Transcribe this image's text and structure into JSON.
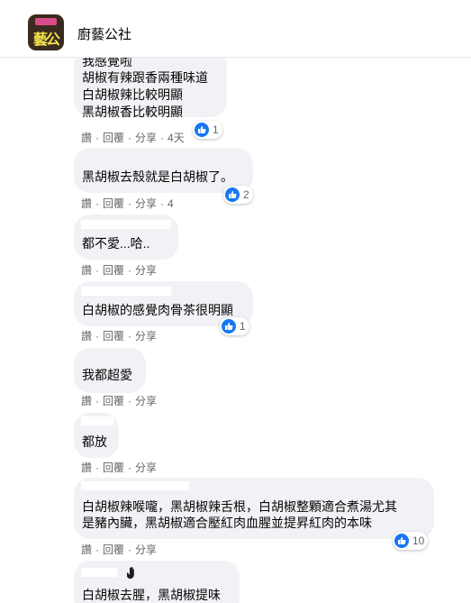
{
  "header": {
    "title": "廚藝公社",
    "avatar_text": "藝公"
  },
  "actions": {
    "like": "讚",
    "reply": "回覆",
    "share": "分享"
  },
  "comments": [
    {
      "lines": [
        "我感覺啦",
        "胡椒有辣跟香兩種味道",
        "白胡椒辣比較明顯",
        "黑胡椒香比較明顯"
      ],
      "time": "4天",
      "reactions": "1"
    },
    {
      "lines": [
        "黑胡椒去殼就是白胡椒了。"
      ],
      "time": "4",
      "reactions": "2"
    },
    {
      "lines": [
        "都不愛...哈.."
      ],
      "time": "",
      "reactions": ""
    },
    {
      "lines": [
        "白胡椒的感覺肉骨茶很明顯"
      ],
      "time": "",
      "reactions": "1"
    },
    {
      "lines": [
        "我都超愛"
      ],
      "time": "",
      "reactions": ""
    },
    {
      "lines": [
        "都放"
      ],
      "time": "",
      "reactions": ""
    },
    {
      "lines": [
        "白胡椒辣喉嚨，黑胡椒辣舌根，白胡椒整顆適合煮湯尤其",
        "是豬內臟，黑胡椒適合壓紅肉血腥並提昇紅肉的本味"
      ],
      "time": "",
      "reactions": "10"
    },
    {
      "lines": [
        "白胡椒去腥，黑胡椒提味"
      ],
      "time": "",
      "reactions": ""
    }
  ]
}
